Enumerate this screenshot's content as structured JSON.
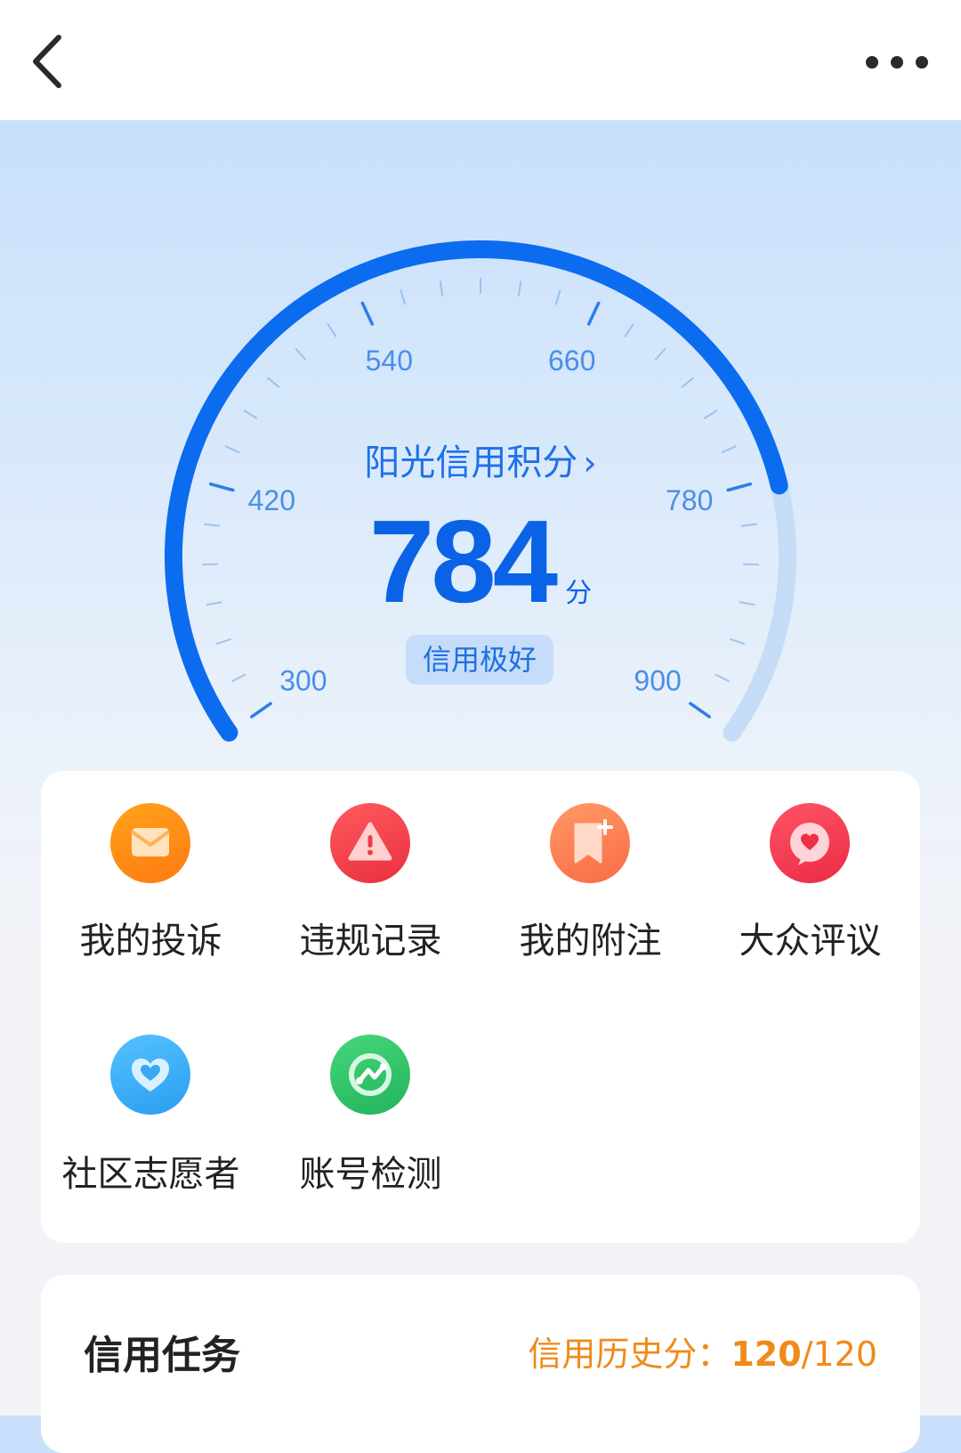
{
  "header": {
    "back_icon": "chevron-left-icon",
    "title": "",
    "more_icon": "more-dots-icon"
  },
  "gauge": {
    "min": 300,
    "max": 900,
    "value": 784,
    "tick_labels": [
      "300",
      "420",
      "540",
      "660",
      "780",
      "900"
    ],
    "link_label": "阳光信用积分",
    "score": "784",
    "unit": "分",
    "level": "信用极好",
    "colors": {
      "progress": "#0b6cf0",
      "track": "#c5dcf7",
      "tick": "#8ab6ee",
      "label": "#4a8fe6"
    }
  },
  "services": [
    {
      "label": "我的投诉",
      "icon": "mail-icon",
      "color_from": "#ffa21a",
      "color_to": "#ff7a12"
    },
    {
      "label": "违规记录",
      "icon": "warning-icon",
      "color_from": "#ff5a5e",
      "color_to": "#e8303e"
    },
    {
      "label": "我的附注",
      "icon": "bookmark-add-icon",
      "color_from": "#ff9a66",
      "color_to": "#f96b46"
    },
    {
      "label": "大众评议",
      "icon": "heart-chat-icon",
      "color_from": "#ff5466",
      "color_to": "#ea2b44"
    },
    {
      "label": "社区志愿者",
      "icon": "heart-hands-icon",
      "color_from": "#55c2ff",
      "color_to": "#2a9df0"
    },
    {
      "label": "账号检测",
      "icon": "scan-check-icon",
      "color_from": "#46d67a",
      "color_to": "#23b35c"
    }
  ],
  "tasks": {
    "title": "信用任务",
    "history_label": "信用历史分：",
    "history_value": "120",
    "history_sep": "/",
    "history_total": "120"
  }
}
